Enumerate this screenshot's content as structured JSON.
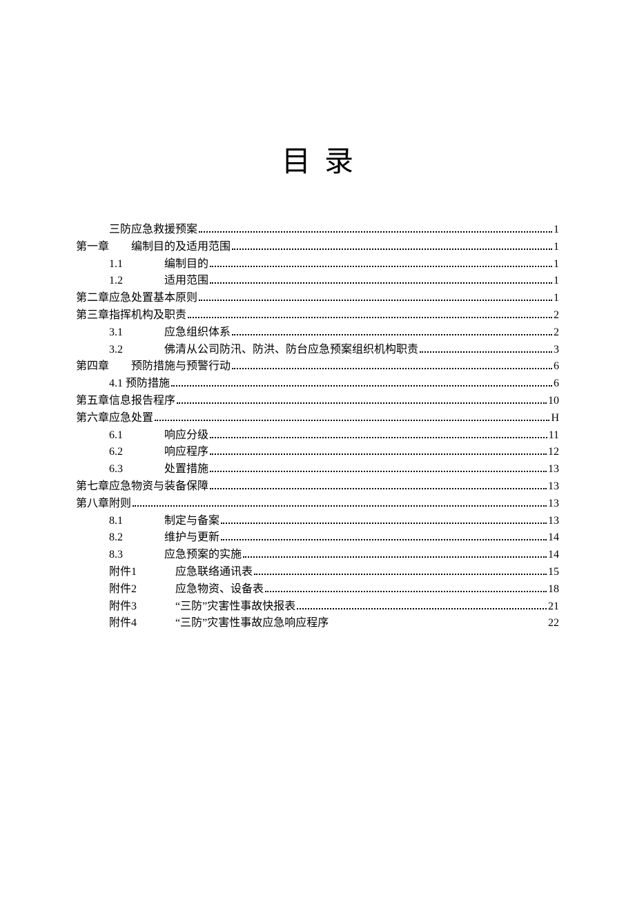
{
  "title": "目录",
  "entries": [
    {
      "indent": 1,
      "prefix": "",
      "text": "三防应急救援预案",
      "page": "1",
      "dots": true
    },
    {
      "indent": 0,
      "prefix": "第一章",
      "text": "编制目的及适用范围",
      "page": "1",
      "dots": true,
      "gap": true
    },
    {
      "indent": 2,
      "prefix": "1.1",
      "text": "编制目的",
      "page": "1",
      "dots": true
    },
    {
      "indent": 2,
      "prefix": "1.2",
      "text": "适用范围",
      "page": "1",
      "dots": true
    },
    {
      "indent": 0,
      "prefix": "第二章应急处置基本原则",
      "text": "",
      "page": "1",
      "dots": true
    },
    {
      "indent": 0,
      "prefix": "第三章指挥机构及职责",
      "text": "",
      "page": "2",
      "dots": true
    },
    {
      "indent": 2,
      "prefix": "3.1",
      "text": "应急组织体系",
      "page": "2",
      "dots": true
    },
    {
      "indent": 2,
      "prefix": "3.2",
      "text": "佛清从公司防汛、防洪、防台应急预案组织机构职责",
      "page": "3",
      "dots": true
    },
    {
      "indent": 0,
      "prefix": "第四章",
      "text": "预防措施与预警行动",
      "page": "6",
      "dots": true,
      "gap": true
    },
    {
      "indent": 2,
      "prefix": "4.1",
      "text": "预防措施",
      "page": "6",
      "dots": true,
      "tight": true
    },
    {
      "indent": 0,
      "prefix": "第五章信息报告程序",
      "text": "",
      "page": "10",
      "dots": true,
      "space": true
    },
    {
      "indent": 0,
      "prefix": "第六章应急处置",
      "text": "",
      "page": "H",
      "dots": true
    },
    {
      "indent": 2,
      "prefix": "6.1",
      "text": "响应分级",
      "page": "11",
      "dots": true
    },
    {
      "indent": 2,
      "prefix": "6.2",
      "text": "响应程序",
      "page": "12",
      "dots": true
    },
    {
      "indent": 2,
      "prefix": "6.3",
      "text": "处置措施",
      "page": "13",
      "dots": true
    },
    {
      "indent": 0,
      "prefix": "第七章应急物资与装备保障",
      "text": "",
      "page": "13",
      "dots": true,
      "space": true
    },
    {
      "indent": 0,
      "prefix": "第八章附则",
      "text": "",
      "page": "13",
      "dots": true,
      "space": true
    },
    {
      "indent": 2,
      "prefix": "8.1",
      "text": "制定与备案",
      "page": "13",
      "dots": true
    },
    {
      "indent": 2,
      "prefix": "8.2",
      "text": "维护与更新",
      "page": "14",
      "dots": true
    },
    {
      "indent": 2,
      "prefix": "8.3",
      "text": "应急预案的实施",
      "page": "14",
      "dots": true
    },
    {
      "indent": 2,
      "prefix": "附件1",
      "text": "应急联络通讯表",
      "page": "15",
      "dots": true,
      "wide": true
    },
    {
      "indent": 2,
      "prefix": "附件2",
      "text": "应急物资、设备表",
      "page": "18",
      "dots": true,
      "wide": true
    },
    {
      "indent": 2,
      "prefix": "附件3",
      "text": "“三防”灾害性事故快报表",
      "page": "21",
      "dots": true,
      "wide": true
    },
    {
      "indent": 2,
      "prefix": "附件4",
      "text": "“三防”灾害性事故应急响应程序",
      "page": "22",
      "dots": false,
      "wide": true
    }
  ]
}
